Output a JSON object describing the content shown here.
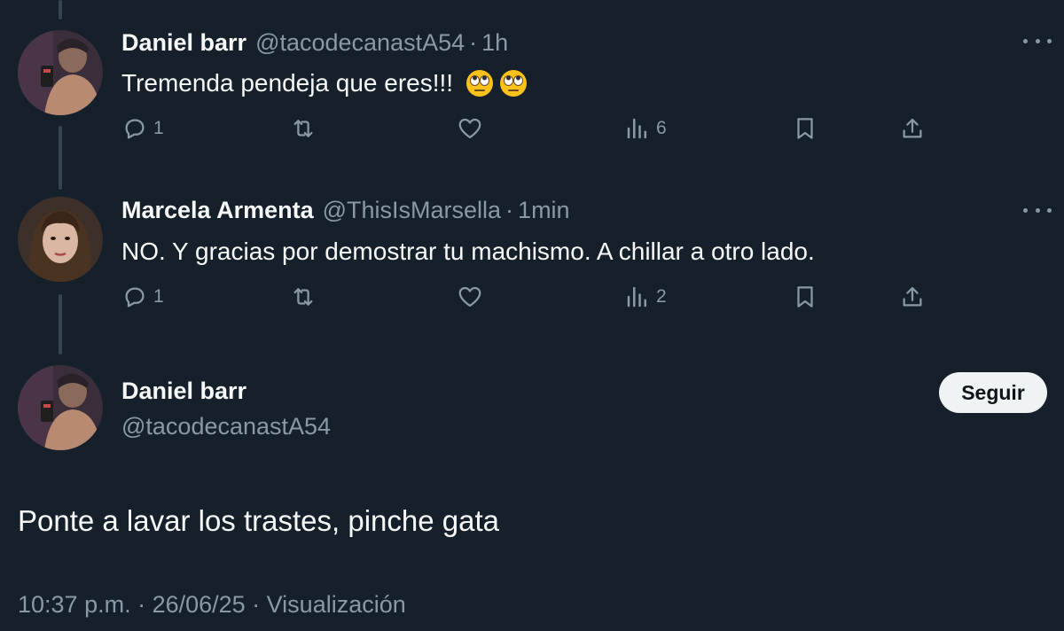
{
  "replies": [
    {
      "name": "Daniel barr",
      "handle": "@tacodecanastA54",
      "time": "1h",
      "text": "Tremenda pendeja que eres!!!",
      "emojis": [
        "face-with-rolling-eyes",
        "face-with-rolling-eyes"
      ],
      "replies_count": "1",
      "views_count": "6"
    },
    {
      "name": "Marcela Armenta",
      "handle": "@ThisIsMarsella",
      "time": "1min",
      "text": "NO. Y gracias por demostrar tu machismo. A chillar a otro lado.",
      "replies_count": "1",
      "views_count": "2"
    }
  ],
  "separator": "·",
  "main_tweet": {
    "name": "Daniel barr",
    "handle": "@tacodecanastA54",
    "follow_label": "Seguir",
    "text": "Ponte a lavar los trastes, pinche gata",
    "meta": "10:37 p.m. · 26/06/25 · Visualización"
  },
  "colors": {
    "background": "#15202b",
    "primary_text": "#f7f9f9",
    "secondary_text": "#8b98a5",
    "thread_line": "#38444d",
    "follow_button_bg": "#eff3f4"
  }
}
